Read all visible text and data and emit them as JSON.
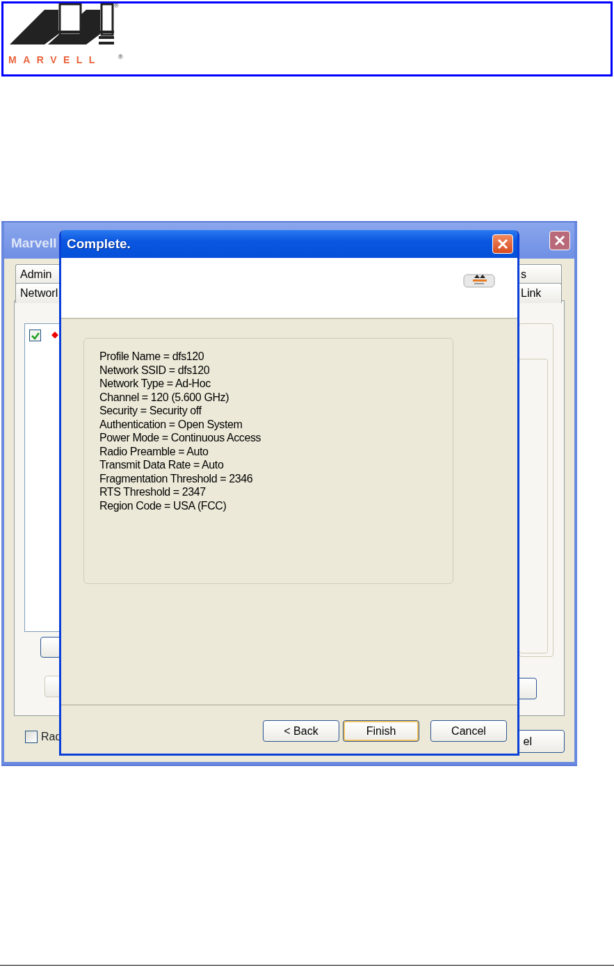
{
  "logo": {
    "wordmark": "MARVELL",
    "marks": [
      "®",
      "®"
    ]
  },
  "back_window": {
    "title": "Marvell",
    "tabs_left": [
      {
        "label": "Admin"
      },
      {
        "label": "Networl"
      }
    ],
    "tabs_right": [
      {
        "label": "s"
      },
      {
        "label": "Link"
      }
    ],
    "list_item": {
      "checked": true
    },
    "option": {
      "label": "Rad",
      "checked": false
    },
    "cut_button": "el"
  },
  "dialog": {
    "title": "Complete.",
    "summary": [
      "Profile Name = dfs120",
      "Network SSID = dfs120",
      "Network Type = Ad-Hoc",
      "Channel = 120 (5.600 GHz)",
      "Security = Security off",
      "Authentication = Open System",
      "Power Mode = Continuous Access",
      "Radio Preamble = Auto",
      "Transmit Data Rate = Auto",
      "Fragmentation Threshold = 2346",
      "RTS Threshold = 2347",
      "Region Code = USA (FCC)"
    ],
    "buttons": [
      {
        "label": "< Back",
        "default": false
      },
      {
        "label": "Finish",
        "default": true
      },
      {
        "label": "Cancel",
        "default": false
      }
    ]
  }
}
